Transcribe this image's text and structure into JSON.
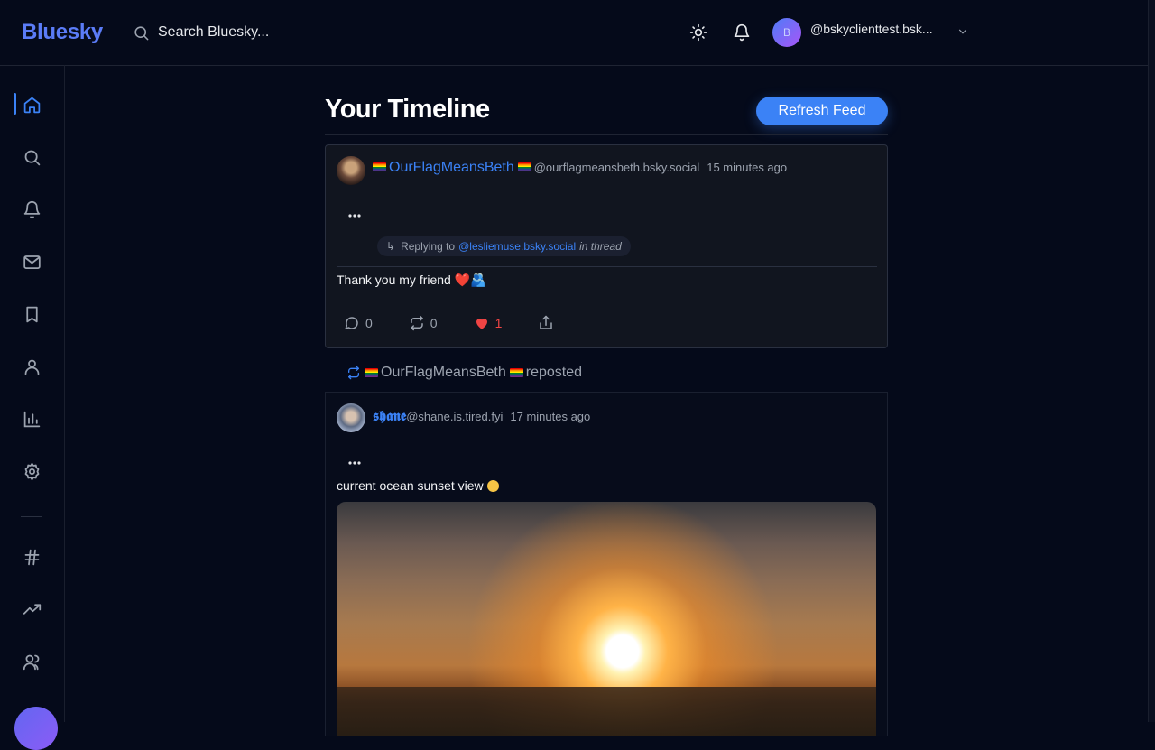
{
  "header": {
    "logo": "Bluesky",
    "search_placeholder": "Search Bluesky...",
    "avatar_initial": "B",
    "user_handle": "@bskyclienttest.bsk..."
  },
  "sidebar": {
    "items": [
      {
        "name": "home",
        "icon": "home-icon",
        "active": true
      },
      {
        "name": "search",
        "icon": "search-icon"
      },
      {
        "name": "notifications",
        "icon": "bell-icon"
      },
      {
        "name": "messages",
        "icon": "mail-icon"
      },
      {
        "name": "bookmarks",
        "icon": "bookmark-icon"
      },
      {
        "name": "profile",
        "icon": "user-icon"
      },
      {
        "name": "analytics",
        "icon": "bar-chart-icon"
      },
      {
        "name": "settings",
        "icon": "gear-icon"
      },
      {
        "name": "hashtags",
        "icon": "hash-icon"
      },
      {
        "name": "trending",
        "icon": "trending-icon"
      },
      {
        "name": "community",
        "icon": "users-icon"
      }
    ]
  },
  "main": {
    "title": "Your Timeline",
    "refresh_label": "Refresh Feed"
  },
  "posts": [
    {
      "display_name": "OurFlagMeansBeth",
      "handle": "@ourflagmeansbeth.bsky.social",
      "time": "15 minutes ago",
      "reply_prefix": "Replying to",
      "reply_mention": "@lesliemuse.bsky.social",
      "reply_suffix": "in thread",
      "text": "Thank you my friend",
      "text_emoji": "❤️🫂",
      "replies": "0",
      "reposts": "0",
      "likes": "1"
    },
    {
      "display_name": "𝖘𝖍𝖆𝖓𝖊",
      "handle": "@shane.is.tired.fyi",
      "time": "17 minutes ago",
      "text": "current ocean sunset view",
      "reposted_by": "OurFlagMeansBeth",
      "reposted_label": "reposted"
    }
  ],
  "colors": {
    "accent": "#3b82f6",
    "background": "#050a1a",
    "like": "#ef4444"
  }
}
